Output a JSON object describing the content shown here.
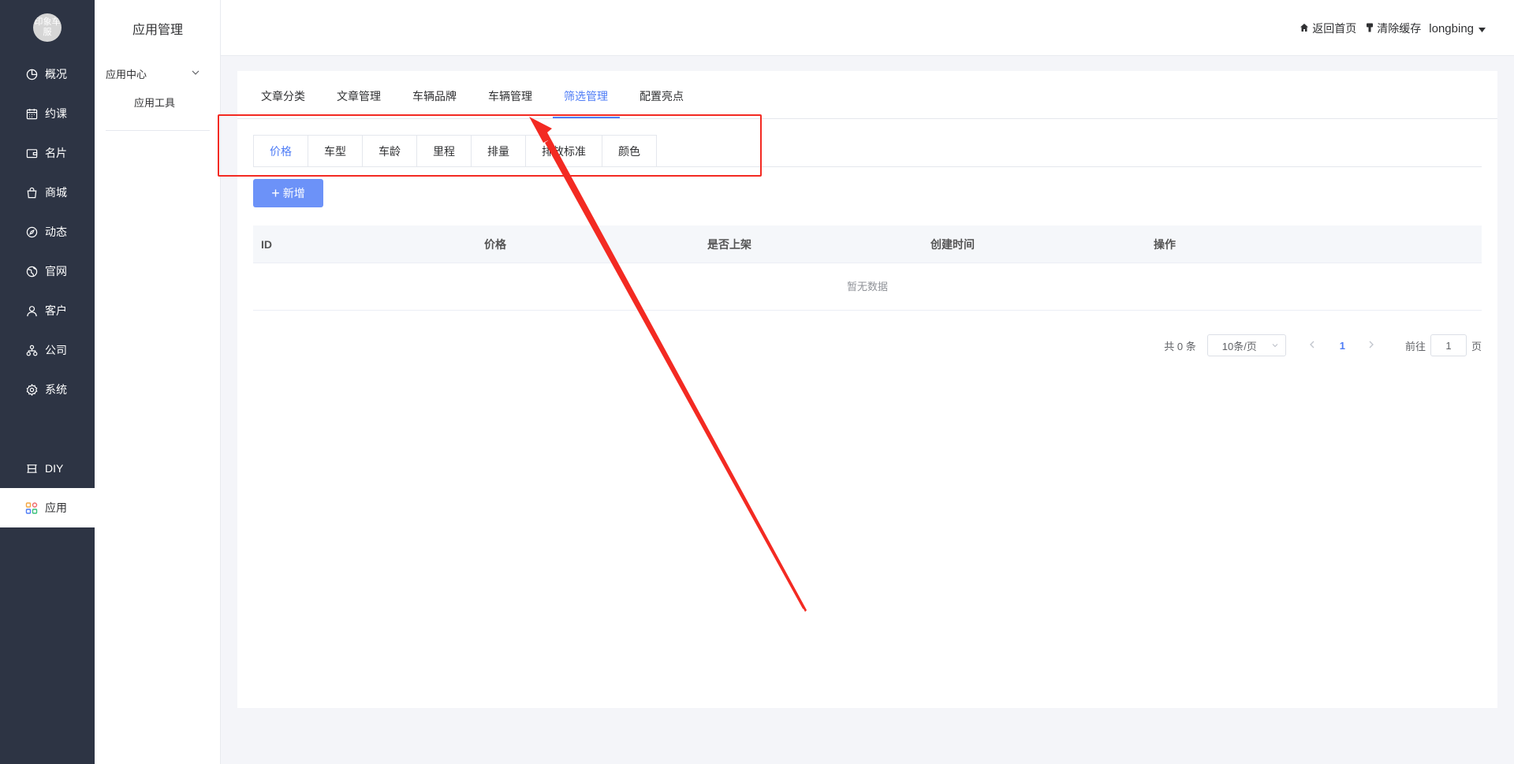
{
  "logo": {
    "text": "印象车服"
  },
  "nav": {
    "items": [
      {
        "label": "概况",
        "icon": "pie-chart-icon"
      },
      {
        "label": "约课",
        "icon": "calendar-icon"
      },
      {
        "label": "名片",
        "icon": "wallet-icon"
      },
      {
        "label": "商城",
        "icon": "shopping-bag-icon"
      },
      {
        "label": "动态",
        "icon": "compass-icon"
      },
      {
        "label": "官网",
        "icon": "globe-icon"
      },
      {
        "label": "客户",
        "icon": "user-icon"
      },
      {
        "label": "公司",
        "icon": "org-chart-icon"
      },
      {
        "label": "系统",
        "icon": "gear-icon"
      }
    ],
    "diy": {
      "label": "DIY",
      "icon": "diy-icon"
    },
    "apps": {
      "label": "应用",
      "icon": "apps-grid-icon"
    }
  },
  "subnav": {
    "title": "应用管理",
    "group": "应用中心",
    "item": "应用工具"
  },
  "header": {
    "home": "返回首页",
    "clear_cache": "清除缓存",
    "user": "longbing"
  },
  "tabs": [
    "文章分类",
    "文章管理",
    "车辆品牌",
    "车辆管理",
    "筛选管理",
    "配置亮点"
  ],
  "active_tab": "筛选管理",
  "filter_tabs": [
    "价格",
    "车型",
    "车龄",
    "里程",
    "排量",
    "排放标准",
    "颜色"
  ],
  "active_filter_tab": "价格",
  "add_button": {
    "label": "新增"
  },
  "table": {
    "columns": [
      "ID",
      "价格",
      "是否上架",
      "创建时间",
      "操作"
    ],
    "empty_text": "暂无数据"
  },
  "pagination": {
    "total": "共 0 条",
    "page_size": "10条/页",
    "current_page": "1",
    "goto_prefix": "前往",
    "goto_value": "1",
    "goto_suffix": "页"
  },
  "colors": {
    "accent": "#4e7cf6",
    "nav_bg": "#2d3444",
    "annotation_red": "#f32a22"
  }
}
